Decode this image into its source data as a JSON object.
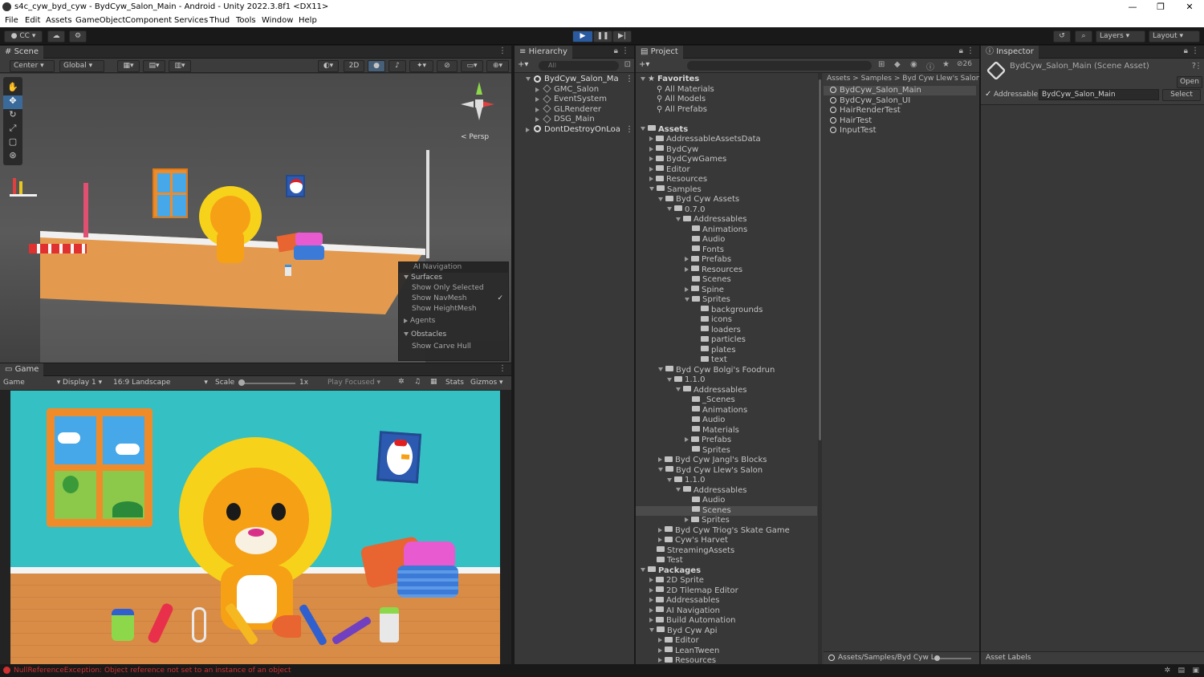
{
  "window": {
    "title": "s4c_cyw_byd_cyw - BydCyw_Salon_Main - Android - Unity 2022.3.8f1 <DX11>",
    "controls": [
      "—",
      "❐",
      "✕"
    ]
  },
  "menu": [
    "File",
    "Edit",
    "Assets",
    "GameObject",
    "Component",
    "Services",
    "Thud",
    "Tools",
    "Window",
    "Help"
  ],
  "toolbar": {
    "account": "CC",
    "layers": "Layers",
    "layout": "Layout"
  },
  "scene": {
    "tab": "Scene",
    "pivot": "Center",
    "space": "Global",
    "two_d": "2D",
    "persp": "< Persp",
    "overlay": {
      "ai_navigation": "AI Navigation",
      "surfaces": "Surfaces",
      "show_only_selected": "Show Only Selected",
      "show_navmesh": "Show NavMesh",
      "show_heightmesh": "Show HeightMesh",
      "agents": "Agents",
      "obstacles": "Obstacles",
      "show_carve_hull": "Show Carve Hull"
    }
  },
  "game": {
    "tab": "Game",
    "mode": "Game",
    "display": "Display 1",
    "aspect": "16:9 Landscape",
    "scale_label": "Scale",
    "scale_value": "1x",
    "play_focused": "Play Focused",
    "stats": "Stats",
    "gizmos": "Gizmos"
  },
  "hierarchy": {
    "tab": "Hierarchy",
    "search_placeholder": "All",
    "items": [
      {
        "label": "BydCyw_Salon_Ma",
        "depth": 0,
        "kind": "scene",
        "expanded": true
      },
      {
        "label": "GMC_Salon",
        "depth": 1,
        "kind": "object"
      },
      {
        "label": "EventSystem",
        "depth": 1,
        "kind": "object"
      },
      {
        "label": "GLRenderer",
        "depth": 1,
        "kind": "object"
      },
      {
        "label": "DSG_Main",
        "depth": 1,
        "kind": "object"
      },
      {
        "label": "DontDestroyOnLoa",
        "depth": 0,
        "kind": "scene"
      }
    ]
  },
  "project": {
    "tab": "Project",
    "hidden_count": "26",
    "breadcrumb": [
      "Assets",
      "Samples",
      "Byd Cyw Llew's Salon"
    ],
    "tree": [
      {
        "label": "Favorites",
        "depth": 0,
        "kind": "star",
        "bold": true,
        "open": true
      },
      {
        "label": "All Materials",
        "depth": 1,
        "kind": "search"
      },
      {
        "label": "All Models",
        "depth": 1,
        "kind": "search"
      },
      {
        "label": "All Prefabs",
        "depth": 1,
        "kind": "search"
      },
      {
        "label": "",
        "depth": 0,
        "kind": "gap"
      },
      {
        "label": "Assets",
        "depth": 0,
        "kind": "folder",
        "bold": true,
        "open": true
      },
      {
        "label": "AddressableAssetsData",
        "depth": 1,
        "kind": "folder",
        "arrow": true
      },
      {
        "label": "BydCyw",
        "depth": 1,
        "kind": "folder",
        "arrow": true
      },
      {
        "label": "BydCywGames",
        "depth": 1,
        "kind": "folder",
        "arrow": true
      },
      {
        "label": "Editor",
        "depth": 1,
        "kind": "folder",
        "arrow": true
      },
      {
        "label": "Resources",
        "depth": 1,
        "kind": "folder",
        "arrow": true
      },
      {
        "label": "Samples",
        "depth": 1,
        "kind": "folder",
        "open": true
      },
      {
        "label": "Byd Cyw Assets",
        "depth": 2,
        "kind": "folder",
        "open": true
      },
      {
        "label": "0.7.0",
        "depth": 3,
        "kind": "folder",
        "open": true
      },
      {
        "label": "Addressables",
        "depth": 4,
        "kind": "folder",
        "open": true
      },
      {
        "label": "Animations",
        "depth": 5,
        "kind": "folder"
      },
      {
        "label": "Audio",
        "depth": 5,
        "kind": "folder"
      },
      {
        "label": "Fonts",
        "depth": 5,
        "kind": "folder"
      },
      {
        "label": "Prefabs",
        "depth": 5,
        "kind": "folder",
        "arrow": true
      },
      {
        "label": "Resources",
        "depth": 5,
        "kind": "folder",
        "arrow": true
      },
      {
        "label": "Scenes",
        "depth": 5,
        "kind": "folder"
      },
      {
        "label": "Spine",
        "depth": 5,
        "kind": "folder",
        "arrow": true
      },
      {
        "label": "Sprites",
        "depth": 5,
        "kind": "folder",
        "open": true
      },
      {
        "label": "backgrounds",
        "depth": 6,
        "kind": "folder"
      },
      {
        "label": "icons",
        "depth": 6,
        "kind": "folder"
      },
      {
        "label": "loaders",
        "depth": 6,
        "kind": "folder"
      },
      {
        "label": "particles",
        "depth": 6,
        "kind": "folder"
      },
      {
        "label": "plates",
        "depth": 6,
        "kind": "folder"
      },
      {
        "label": "text",
        "depth": 6,
        "kind": "folder"
      },
      {
        "label": "Byd Cyw Bolgi's Foodrun",
        "depth": 2,
        "kind": "folder",
        "open": true
      },
      {
        "label": "1.1.0",
        "depth": 3,
        "kind": "folder",
        "open": true
      },
      {
        "label": "Addressables",
        "depth": 4,
        "kind": "folder",
        "open": true
      },
      {
        "label": "_Scenes",
        "depth": 5,
        "kind": "folder"
      },
      {
        "label": "Animations",
        "depth": 5,
        "kind": "folder"
      },
      {
        "label": "Audio",
        "depth": 5,
        "kind": "folder"
      },
      {
        "label": "Materials",
        "depth": 5,
        "kind": "folder"
      },
      {
        "label": "Prefabs",
        "depth": 5,
        "kind": "folder",
        "arrow": true
      },
      {
        "label": "Sprites",
        "depth": 5,
        "kind": "folder"
      },
      {
        "label": "Byd Cyw Jangl's Blocks",
        "depth": 2,
        "kind": "folder",
        "arrow": true
      },
      {
        "label": "Byd Cyw Llew's Salon",
        "depth": 2,
        "kind": "folder",
        "open": true
      },
      {
        "label": "1.1.0",
        "depth": 3,
        "kind": "folder",
        "open": true
      },
      {
        "label": "Addressables",
        "depth": 4,
        "kind": "folder",
        "open": true
      },
      {
        "label": "Audio",
        "depth": 5,
        "kind": "folder"
      },
      {
        "label": "Scenes",
        "depth": 5,
        "kind": "folder",
        "highlight": true
      },
      {
        "label": "Sprites",
        "depth": 5,
        "kind": "folder",
        "arrow": true
      },
      {
        "label": "Byd Cyw Triog's Skate Game",
        "depth": 2,
        "kind": "folder",
        "arrow": true
      },
      {
        "label": "Cyw's Harvet",
        "depth": 2,
        "kind": "folder",
        "arrow": true
      },
      {
        "label": "StreamingAssets",
        "depth": 1,
        "kind": "folder"
      },
      {
        "label": "Test",
        "depth": 1,
        "kind": "folder"
      },
      {
        "label": "Packages",
        "depth": 0,
        "kind": "folder",
        "bold": true,
        "open": true
      },
      {
        "label": "2D Sprite",
        "depth": 1,
        "kind": "folder",
        "arrow": true
      },
      {
        "label": "2D Tilemap Editor",
        "depth": 1,
        "kind": "folder",
        "arrow": true
      },
      {
        "label": "Addressables",
        "depth": 1,
        "kind": "folder",
        "arrow": true
      },
      {
        "label": "AI Navigation",
        "depth": 1,
        "kind": "folder",
        "arrow": true
      },
      {
        "label": "Build Automation",
        "depth": 1,
        "kind": "folder",
        "arrow": true
      },
      {
        "label": "Byd Cyw Api",
        "depth": 1,
        "kind": "folder",
        "open": true
      },
      {
        "label": "Editor",
        "depth": 2,
        "kind": "folder",
        "arrow": true
      },
      {
        "label": "LeanTween",
        "depth": 2,
        "kind": "folder",
        "arrow": true
      },
      {
        "label": "Resources",
        "depth": 2,
        "kind": "folder",
        "arrow": true
      }
    ],
    "files": [
      {
        "label": "BydCyw_Salon_Main",
        "selected": true
      },
      {
        "label": "BydCyw_Salon_UI"
      },
      {
        "label": "HairRenderTest"
      },
      {
        "label": "HairTest"
      },
      {
        "label": "InputTest"
      }
    ],
    "footer_path": "Assets/Samples/Byd Cyw L"
  },
  "inspector": {
    "tab": "Inspector",
    "title": "BydCyw_Salon_Main (Scene Asset)",
    "open_button": "Open",
    "addressable_label": "Addressable",
    "addressable_value": "BydCyw_Salon_Main",
    "select_button": "Select",
    "asset_labels": "Asset Labels"
  },
  "status": {
    "message": "NullReferenceException: Object reference not set to an instance of an object"
  },
  "colors": {
    "accent": "#2c5d87",
    "game_bg": "#35c0c3",
    "floor": "#e39a4f",
    "lion_mane": "#f7d21a",
    "lion_face": "#f6a016",
    "error": "#d03030"
  }
}
